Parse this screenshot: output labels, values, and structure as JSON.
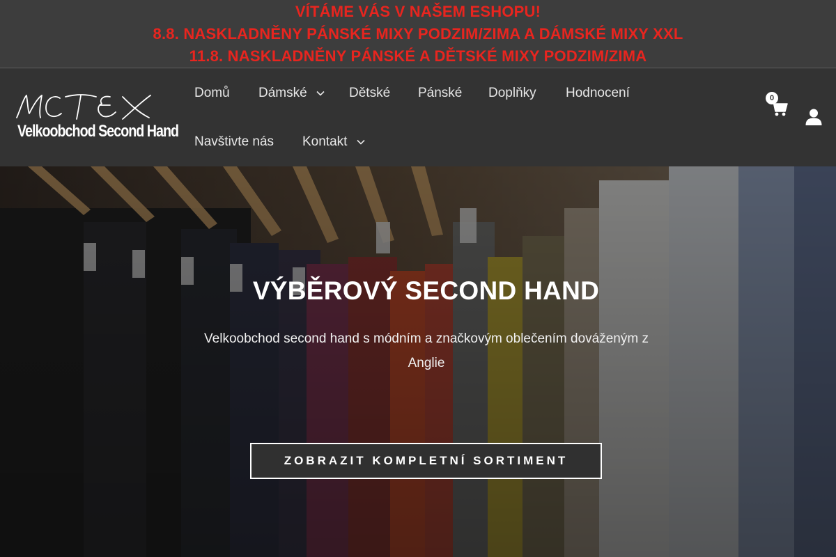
{
  "announcement": {
    "line1": "VÍTÁME VÁS V NAŠEM ESHOPU!",
    "line2": "8.8. NASKLADNĚNY PÁNSKÉ MIXY PODZIM/ZIMA A DÁMSKÉ MIXY XXL",
    "line3": "11.8. NASKLADNĚNY PÁNSKÉ A DĚTSKÉ MIXY PODZIM/ZIMA",
    "color": "#e8251f"
  },
  "logo": {
    "script_text": "MCTEX",
    "subtitle": "Velkoobchod Second Hand"
  },
  "nav": {
    "items": [
      {
        "label": "Domů"
      },
      {
        "label": "Dámské",
        "has_dropdown": true
      },
      {
        "label": "Dětské"
      },
      {
        "label": "Pánské"
      },
      {
        "label": "Doplňky"
      },
      {
        "label": "Hodnocení"
      },
      {
        "label": "Navštivte nás"
      },
      {
        "label": "Kontakt",
        "has_dropdown": true
      }
    ]
  },
  "cart": {
    "count": "0",
    "icon": "cart-icon"
  },
  "account": {
    "icon": "user-icon"
  },
  "hero": {
    "title": "VÝBĚROVÝ SECOND HAND",
    "subtitle": "Velkoobchod second hand s módním a značkovým oblečením dováženým z Anglie",
    "cta_label": "ZOBRAZIT KOMPLETNÍ SORTIMENT"
  }
}
